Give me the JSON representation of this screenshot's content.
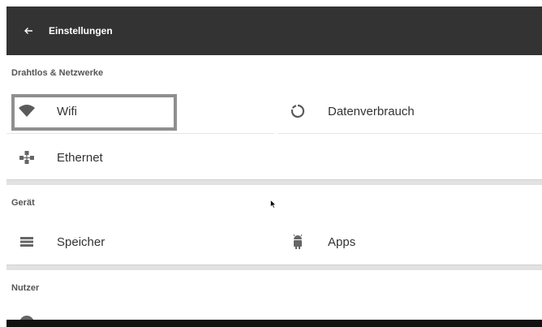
{
  "appbar": {
    "title": "Einstellungen",
    "back_icon": "arrow-back-icon",
    "background": "#333333"
  },
  "sections": [
    {
      "header": "Drahtlos & Netzwerke",
      "items": [
        {
          "label": "Wifi",
          "icon": "wifi-icon",
          "focused": true
        },
        {
          "label": "Datenverbrauch",
          "icon": "data-usage-icon"
        },
        {
          "label": "Ethernet",
          "icon": "ethernet-icon"
        }
      ]
    },
    {
      "header": "Gerät",
      "items": [
        {
          "label": "Speicher",
          "icon": "storage-icon"
        },
        {
          "label": "Apps",
          "icon": "android-icon"
        }
      ]
    },
    {
      "header": "Nutzer",
      "items": []
    }
  ],
  "colors": {
    "focus_border": "#8f8f8f",
    "section_separator": "#e2e2e2",
    "icon": "#666666"
  }
}
